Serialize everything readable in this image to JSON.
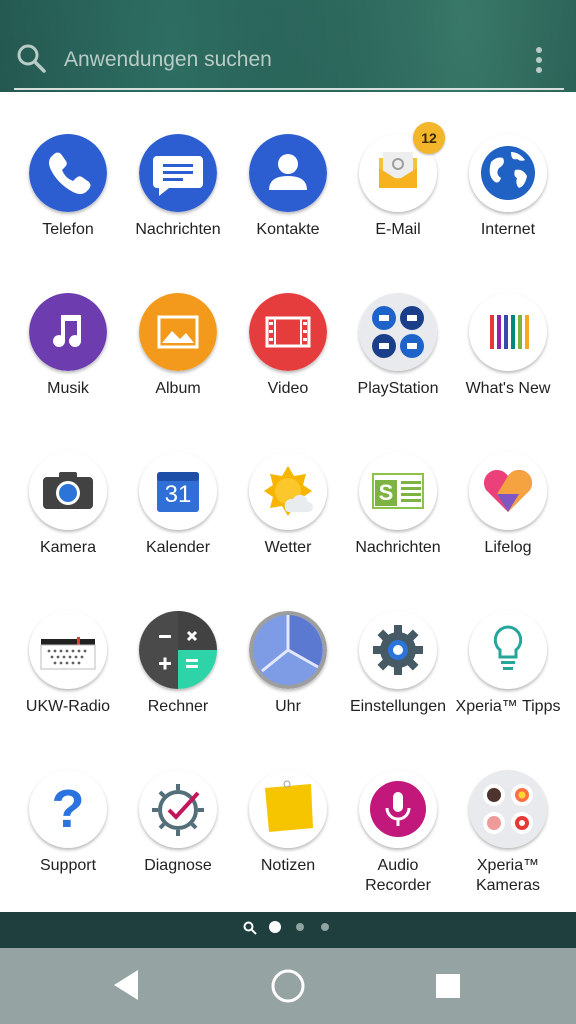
{
  "search": {
    "placeholder": "Anwendungen suchen",
    "icon": "search-icon",
    "menu_icon": "more-vert-icon"
  },
  "apps": [
    {
      "label": "Telefon",
      "icon": "phone-icon"
    },
    {
      "label": "Nachrichten",
      "icon": "messages-icon"
    },
    {
      "label": "Kontakte",
      "icon": "contacts-icon"
    },
    {
      "label": "E-Mail",
      "icon": "email-icon",
      "badge": "12"
    },
    {
      "label": "Internet",
      "icon": "globe-icon"
    },
    {
      "label": "Musik",
      "icon": "music-icon"
    },
    {
      "label": "Album",
      "icon": "album-icon"
    },
    {
      "label": "Video",
      "icon": "video-icon"
    },
    {
      "label": "PlayStation",
      "icon": "playstation-icon"
    },
    {
      "label": "What's New",
      "icon": "whats-new-icon"
    },
    {
      "label": "Kamera",
      "icon": "camera-icon"
    },
    {
      "label": "Kalender",
      "icon": "calendar-icon",
      "icon_text": "31"
    },
    {
      "label": "Wetter",
      "icon": "weather-icon"
    },
    {
      "label": "Nachrichten",
      "icon": "news-icon",
      "icon_text": "S"
    },
    {
      "label": "Lifelog",
      "icon": "lifelog-icon"
    },
    {
      "label": "UKW-Radio",
      "icon": "radio-icon"
    },
    {
      "label": "Rechner",
      "icon": "calculator-icon"
    },
    {
      "label": "Uhr",
      "icon": "clock-icon"
    },
    {
      "label": "Einstellungen",
      "icon": "settings-icon"
    },
    {
      "label": "Xperia™ Tipps",
      "icon": "lightbulb-icon"
    },
    {
      "label": "Support",
      "icon": "question-icon",
      "icon_text": "?"
    },
    {
      "label": "Diagnose",
      "icon": "diagnostics-icon"
    },
    {
      "label": "Notizen",
      "icon": "notes-icon"
    },
    {
      "label": "Audio Recorder",
      "icon": "microphone-icon"
    },
    {
      "label": "Xperia™ Kameras",
      "icon": "cameras-icon"
    }
  ],
  "page_indicator": {
    "pages": 3,
    "active": 0,
    "search_icon": "search-icon"
  },
  "navbar": {
    "back": "back-icon",
    "home": "home-icon",
    "recents": "recents-icon"
  },
  "colors": {
    "accent_badge": "#f3b62a",
    "panel_bg": "#ffffff",
    "navbar_bg": "#96a3a3"
  }
}
